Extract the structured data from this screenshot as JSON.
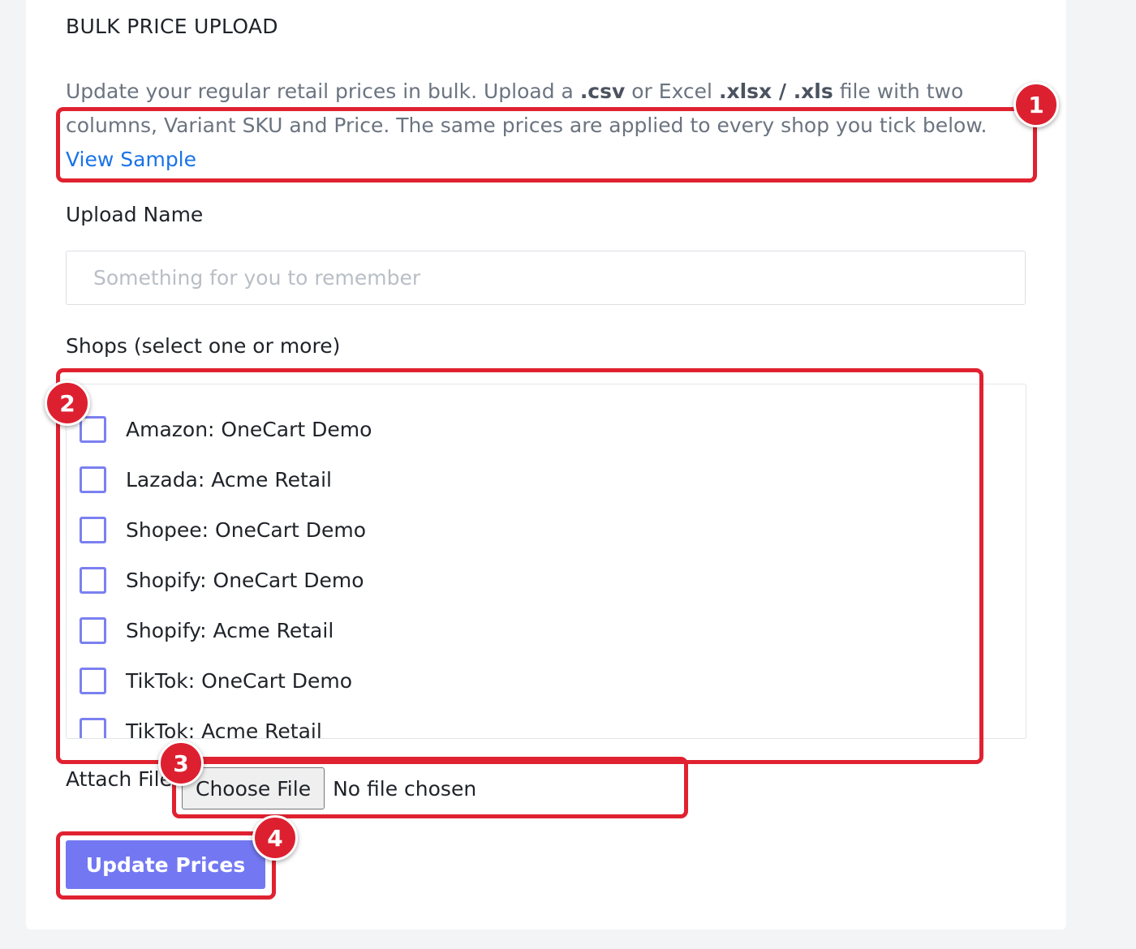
{
  "header": {
    "title": "BULK PRICE UPLOAD"
  },
  "description": {
    "text_1": "Update your regular retail prices in bulk. Upload a ",
    "fmt_csv": ".csv",
    "text_2": " or Excel ",
    "fmt_excel": ".xlsx / .xls",
    "text_3": " file with two columns, Variant SKU and Price. The same prices are applied to every shop you tick below. ",
    "link": "View Sample"
  },
  "upload_name": {
    "label": "Upload Name",
    "placeholder": "Something for you to remember",
    "value": ""
  },
  "shops": {
    "label": "Shops (select one or more)",
    "items": [
      {
        "label": "Amazon: OneCart Demo",
        "checked": false
      },
      {
        "label": "Lazada: Acme Retail",
        "checked": false
      },
      {
        "label": "Shopee: OneCart Demo",
        "checked": false
      },
      {
        "label": "Shopify: OneCart Demo",
        "checked": false
      },
      {
        "label": "Shopify: Acme Retail",
        "checked": false
      },
      {
        "label": "TikTok: OneCart Demo",
        "checked": false
      },
      {
        "label": "TikTok: Acme Retail",
        "checked": false
      }
    ]
  },
  "attach": {
    "label": "Attach File",
    "button": "Choose File",
    "status": "No file chosen"
  },
  "submit": {
    "label": "Update Prices"
  },
  "annotations": {
    "badges": [
      "1",
      "2",
      "3",
      "4"
    ],
    "color": "#e02230"
  },
  "colors": {
    "accent": "#7378f2",
    "link": "#1a73e8",
    "checkbox_border": "#7b80f0"
  }
}
